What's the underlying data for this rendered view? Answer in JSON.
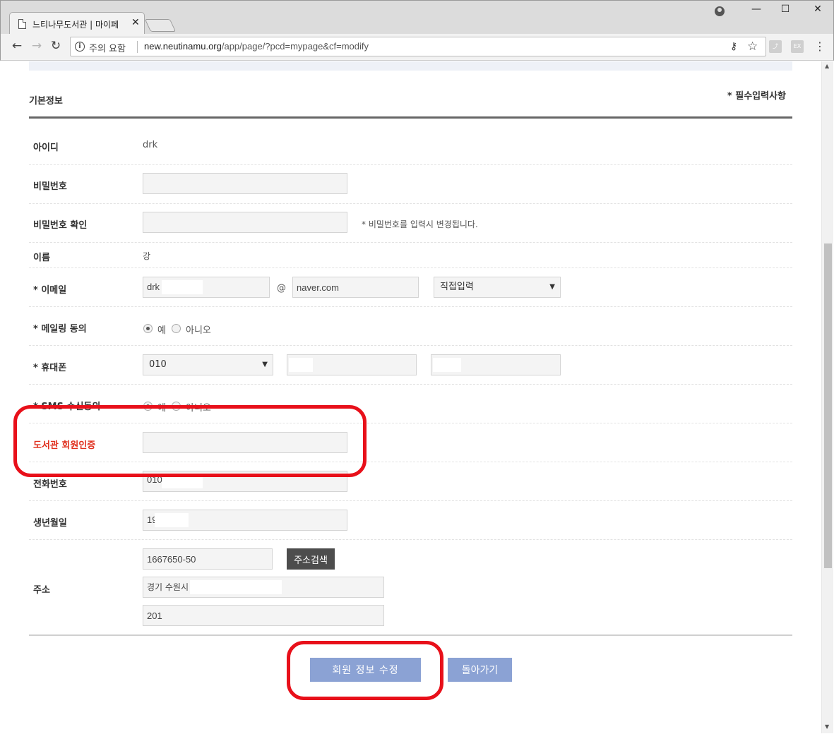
{
  "browser": {
    "tab_title": "느티나무도서관 | 마이페",
    "tab_close": "✕",
    "window_controls": {
      "minimize": "—",
      "maximize": "☐",
      "close": "✕"
    },
    "security_label": "주의 요함",
    "url_host": "new.neutinamu.org",
    "url_path": "/app/page/?pcd=mypage&cf=modify",
    "extensions": [
      "pdf-icon",
      "ex-icon"
    ],
    "ext_ex_label": "EX"
  },
  "page": {
    "section_title": "기본정보",
    "required_note": "* 필수입력사항",
    "rows": {
      "id": {
        "label": "아이디",
        "value": "drk"
      },
      "password": {
        "label": "비밀번호"
      },
      "password_confirm": {
        "label": "비밀번호 확인",
        "helper": "* 비밀번호를 입력시 변경됩니다."
      },
      "name": {
        "label": "이름",
        "value": "강"
      },
      "email": {
        "label": "* 이메일",
        "local_value": "drk",
        "at": "@",
        "domain_value": "naver.com",
        "domain_select": "직접입력"
      },
      "mailing": {
        "label": "* 메일링 동의",
        "yes": "예",
        "no": "아니오",
        "selected": "예"
      },
      "mobile": {
        "label": "* 휴대폰",
        "prefix": "010"
      },
      "sms": {
        "label": "* SMS 수신동의",
        "yes": "예",
        "no": "아니오"
      },
      "library_auth": {
        "label": "도서관 회원인증"
      },
      "phone": {
        "label": "전화번호",
        "value": "010"
      },
      "birth": {
        "label": "생년월일",
        "value": "19"
      },
      "address": {
        "label": "주소",
        "zipcode": "1667650-50",
        "search_button": "주소검색",
        "line1": "경기 수원시",
        "line2": "201"
      }
    },
    "submit_button": "회원 정보 수정",
    "back_button": "돌아가기"
  },
  "colors": {
    "accent_button": "#8ba2d4",
    "highlight_red": "#e8101a",
    "label_red": "#e0301e",
    "dark_button": "#4d4d4d"
  }
}
